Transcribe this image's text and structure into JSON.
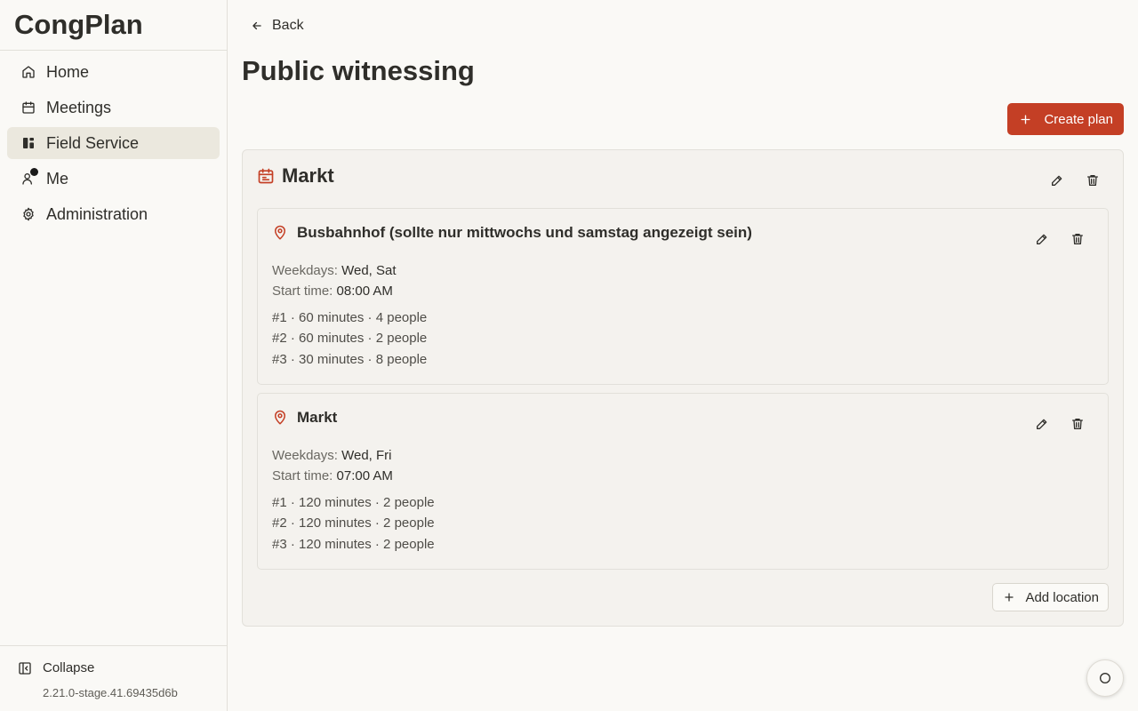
{
  "app": {
    "name": "CongPlan"
  },
  "sidebar": {
    "items": [
      {
        "label": "Home",
        "icon": "home-icon"
      },
      {
        "label": "Meetings",
        "icon": "calendar-icon"
      },
      {
        "label": "Field Service",
        "icon": "field-service-icon",
        "active": true
      },
      {
        "label": "Me",
        "icon": "user-icon",
        "notification": true
      },
      {
        "label": "Administration",
        "icon": "gear-icon"
      }
    ],
    "collapse_label": "Collapse",
    "version": "2.21.0-stage.41.69435d6b"
  },
  "header": {
    "back_label": "Back",
    "title": "Public witnessing",
    "create_label": "Create plan"
  },
  "plan": {
    "title": "Markt",
    "locations": [
      {
        "name": "Busbahnhof (sollte nur mittwochs und samstag angezeigt sein)",
        "weekdays_label": "Weekdays:",
        "weekdays": "Wed, Sat",
        "start_label": "Start time:",
        "start_time": "08:00 AM",
        "shifts": [
          "#1 · 60 minutes · 4 people",
          "#2 · 60 minutes · 2 people",
          "#3 · 30 minutes · 8 people"
        ]
      },
      {
        "name": "Markt",
        "weekdays_label": "Weekdays:",
        "weekdays": "Wed, Fri",
        "start_label": "Start time:",
        "start_time": "07:00 AM",
        "shifts": [
          "#1 · 120 minutes · 2 people",
          "#2 · 120 minutes · 2 people",
          "#3 · 120 minutes · 2 people"
        ]
      }
    ],
    "add_location_label": "Add location"
  },
  "colors": {
    "accent": "#c43f25",
    "background": "#faf9f6",
    "card": "#f4f2ee"
  }
}
